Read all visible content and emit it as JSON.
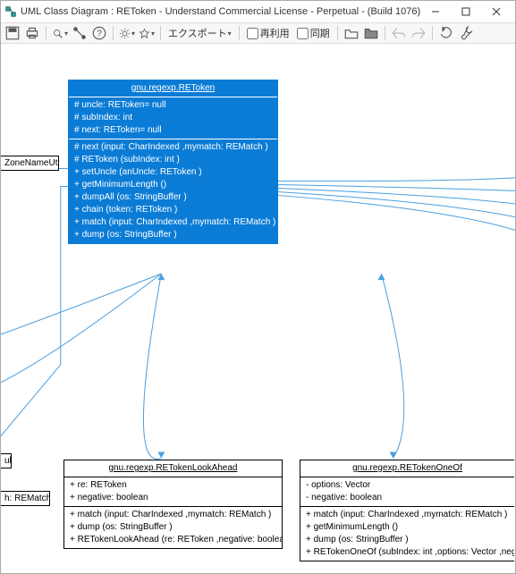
{
  "window": {
    "title": "UML Class Diagram : REToken - Understand Commercial License - Perpetual - (Build 1076)"
  },
  "toolbar": {
    "export_label": "エクスポート",
    "reuse_label": "再利用",
    "sync_label": "同期"
  },
  "main_class": {
    "name": "gnu.regexp.REToken",
    "attrs": [
      "# uncle: REToken= null",
      "# subIndex: int",
      "# next: REToken= null"
    ],
    "ops": [
      "# next (input: CharIndexed ,mymatch: REMatch )",
      "# REToken (subIndex: int )",
      "+ setUncle (anUncle: REToken )",
      "+ getMinimumLength ()",
      "+ dumpAll (os: StringBuffer )",
      "+ chain (token: REToken )",
      "+ match (input: CharIndexed ,mymatch: REMatch )",
      "+ dump (os: StringBuffer )"
    ]
  },
  "lookahead_class": {
    "name": "gnu.regexp.RETokenLookAhead",
    "attrs": [
      "+ re: REToken",
      "+ negative: boolean"
    ],
    "ops": [
      "+ match (input: CharIndexed ,mymatch: REMatch )",
      "+ dump (os: StringBuffer )",
      "+ RETokenLookAhead (re: REToken ,negative: boolean )"
    ]
  },
  "oneof_class": {
    "name": "gnu.regexp.RETokenOneOf",
    "attrs": [
      "- options: Vector",
      "- negative: boolean"
    ],
    "ops": [
      "+ match (input: CharIndexed ,mymatch: REMatch )",
      "+ getMinimumLength ()",
      "+ dump (os: StringBuffer )",
      "+ RETokenOneOf (subIndex: int ,options: Vector ,negative: boolean )"
    ]
  },
  "left_partial_1": "ZoneNameUtility",
  "left_partial_2": "ub",
  "left_partial_3": "h: REMatch )",
  "chart_data": {
    "type": "diagram",
    "title": "UML Class Diagram : REToken",
    "classes": [
      {
        "name": "gnu.regexp.REToken",
        "highlight": true,
        "attributes": [
          "# uncle: REToken = null",
          "# subIndex: int",
          "# next: REToken = null"
        ],
        "operations": [
          "# next(input: CharIndexed, mymatch: REMatch)",
          "# REToken(subIndex: int)",
          "+ setUncle(anUncle: REToken)",
          "+ getMinimumLength()",
          "+ dumpAll(os: StringBuffer)",
          "+ chain(token: REToken)",
          "+ match(input: CharIndexed, mymatch: REMatch)",
          "+ dump(os: StringBuffer)"
        ]
      },
      {
        "name": "gnu.regexp.RETokenLookAhead",
        "attributes": [
          "+ re: REToken",
          "+ negative: boolean"
        ],
        "operations": [
          "+ match(input: CharIndexed, mymatch: REMatch)",
          "+ dump(os: StringBuffer)",
          "+ RETokenLookAhead(re: REToken, negative: boolean)"
        ]
      },
      {
        "name": "gnu.regexp.RETokenOneOf",
        "attributes": [
          "- options: Vector",
          "- negative: boolean"
        ],
        "operations": [
          "+ match(input: CharIndexed, mymatch: REMatch)",
          "+ getMinimumLength()",
          "+ dump(os: StringBuffer)",
          "+ RETokenOneOf(subIndex: int, options: Vector, negative: boolean)"
        ]
      }
    ],
    "relationships": [
      {
        "from": "gnu.regexp.RETokenLookAhead",
        "to": "gnu.regexp.REToken",
        "type": "generalization"
      },
      {
        "from": "gnu.regexp.RETokenOneOf",
        "to": "gnu.regexp.REToken",
        "type": "generalization"
      }
    ]
  }
}
